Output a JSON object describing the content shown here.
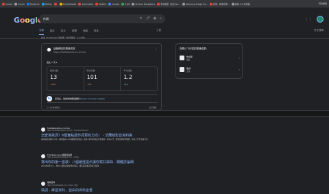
{
  "bookmarks": [
    {
      "label": "Insider",
      "color": "#ea4335"
    },
    {
      "label": "iCloud",
      "color": "#9aa0a6"
    },
    {
      "label": "Facebook",
      "color": "#1877f2"
    },
    {
      "label": "Twitter",
      "color": "#1da1f2"
    },
    {
      "label": "",
      "color": "#ea4335"
    },
    {
      "label": "DriveHelvete",
      "color": "#fbbc04"
    },
    {
      "label": "SaturGlobe",
      "color": "#ea4335"
    },
    {
      "label": "WebPro",
      "color": "#ea4335"
    },
    {
      "label": "Google",
      "color": "#4285f4"
    },
    {
      "label": "E-UR",
      "color": "#34a853"
    },
    {
      "label": "All Gian Navigators",
      "color": "#9aa0a6"
    },
    {
      "label": "東中國華（如文rea...",
      "color": "#ea4335"
    },
    {
      "label": "Samsung Image fro...",
      "color": "#9aa0a6"
    },
    {
      "label": "音樂，娛樂發佈...",
      "color": "#ea4335"
    },
    {
      "label": "廣播 4.0 於廣播",
      "color": "#9aa0a6"
    }
  ],
  "bookmarks_right": "其他書籤",
  "logo": "Google",
  "logo_colors": [
    "#8ab4f8",
    "#f28b82",
    "#fdd663",
    "#8ab4f8",
    "#81c995",
    "#f28b82"
  ],
  "search": {
    "query": "作詞"
  },
  "tabs": [
    {
      "label": "全部",
      "active": true
    },
    {
      "label": "圖片",
      "active": false
    },
    {
      "label": "影片",
      "active": false
    },
    {
      "label": "新聞",
      "active": false
    },
    {
      "label": "地圖",
      "active": false
    },
    {
      "label": "更多",
      "active": false
    }
  ],
  "tools": "工具",
  "safesearch": "安全搜尋",
  "stats": "約有 87,000,000 項結果（搜尋時間：0.43 秒）",
  "card": {
    "site_name": "這個網站的搜尋成效",
    "site_url": "https://findfastsolution.com.tw/",
    "period": "過去 7 天 ▾",
    "metrics": [
      {
        "label": "點擊次數",
        "value": "13",
        "change": "−40%",
        "trend": "neg"
      },
      {
        "label": "曝光次數",
        "value": "101",
        "change": "−8%",
        "trend": "neg"
      },
      {
        "label": "平均排名",
        "value": "1.2",
        "change": "+0.2",
        "trend": "pos"
      }
    ],
    "gsc_prefix": "好消息，透過你的網站瞭解",
    "gsc_link": "Search Console Insights",
    "footer_left": "ⓘ 只有你看得到",
    "footer_right": "意見回饋"
  },
  "panel": {
    "title": "查看以下內容的搜尋結果：",
    "items": [
      {
        "title": "作詞家",
        "subtitle": "職業"
      },
      {
        "title": "歌詞",
        "subtitle": "主題"
      }
    ]
  },
  "results": [
    {
      "site": "findfastsolution.com.tw",
      "url": "https://findfastsolution.com.tw › how-to-write-lyric",
      "title": "怎麼寫歌詞？6個實點讓作詞更有方向！ - 法蘭條影音資料庫",
      "snippet": "歌詞寫給各種人分享...因為很多人心中都很想寫歌詞，很多人的作詞就是什麼東西...作詞入門，從學音樂寫作開始，作詞入門方法與分享。"
    },
    {
      "site": "The News Lens 關鍵評論網",
      "url": "https://www.thenewslens.com › article",
      "title": "寫出你的第一首歌：八個絕佳提示讓你寫好歌曲 - 關鍵評論網",
      "snippet": "2020年6月5日 — 你可以選擇先寫旋律再填詞，或者先寫歌詞再配上旋律..."
    },
    {
      "site": "維基百科",
      "url": "https://zh.wikipedia.org › zh-tw › 填詞",
      "title": "填詞 - 維基百科，自由的百科全書",
      "snippet": ""
    }
  ]
}
